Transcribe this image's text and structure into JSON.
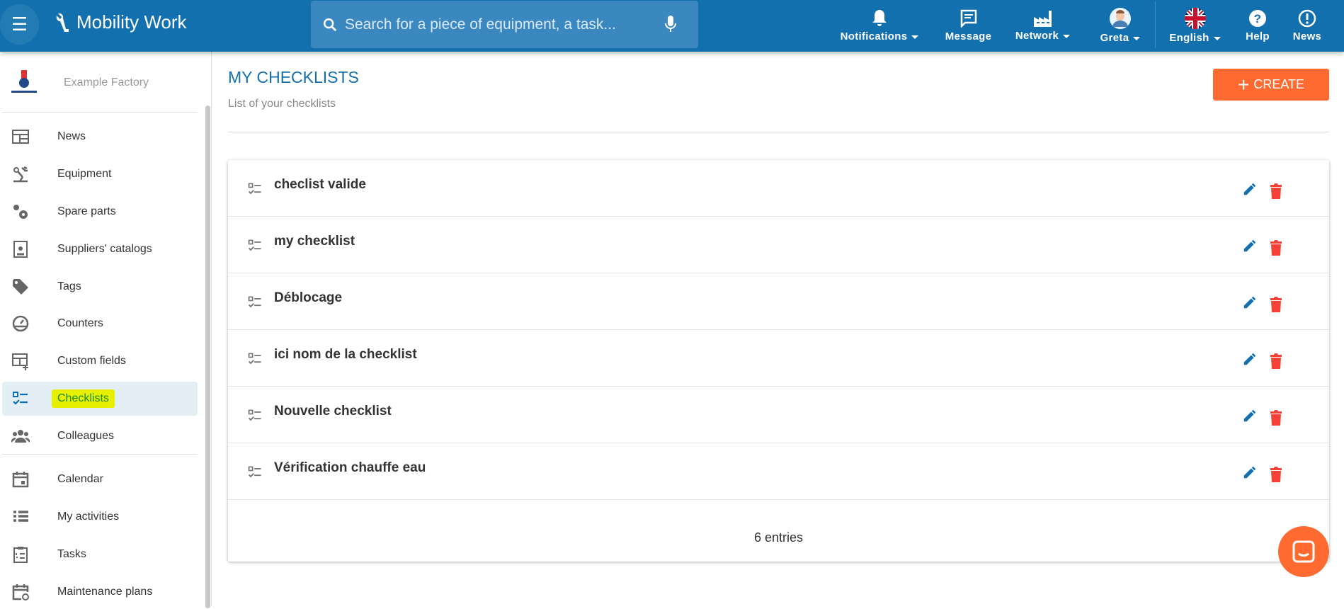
{
  "header": {
    "brand": "Mobility Work",
    "search_placeholder": "Search for a piece of equipment, a task...",
    "nav": [
      {
        "label": "Notifications",
        "icon": "bell-icon"
      },
      {
        "label": "Message",
        "icon": "message-icon"
      },
      {
        "label": "Network",
        "icon": "factory-icon"
      },
      {
        "label": "Greta",
        "icon": "avatar"
      },
      {
        "label": "English",
        "icon": "uk-flag-icon"
      },
      {
        "label": "Help",
        "icon": "help-icon"
      },
      {
        "label": "News",
        "icon": "info-icon"
      }
    ]
  },
  "sidebar": {
    "company": "Example Factory",
    "items": [
      {
        "label": "News",
        "icon": "newspaper-icon"
      },
      {
        "label": "Equipment",
        "icon": "equipment-icon"
      },
      {
        "label": "Spare parts",
        "icon": "gears-icon"
      },
      {
        "label": "Suppliers' catalogs",
        "icon": "catalog-icon"
      },
      {
        "label": "Tags",
        "icon": "tag-icon"
      },
      {
        "label": "Counters",
        "icon": "gauge-icon"
      },
      {
        "label": "Custom fields",
        "icon": "table-plus-icon"
      },
      {
        "label": "Checklists",
        "icon": "checklist-icon",
        "active": true
      },
      {
        "label": "Colleagues",
        "icon": "people-icon"
      },
      {
        "label": "Calendar",
        "icon": "calendar-icon"
      },
      {
        "label": "My activities",
        "icon": "list-icon"
      },
      {
        "label": "Tasks",
        "icon": "clipboard-icon"
      },
      {
        "label": "Maintenance plans",
        "icon": "calendar-sync-icon"
      }
    ]
  },
  "main": {
    "title": "MY CHECKLISTS",
    "subtitle": "List of your checklists",
    "create_label": "CREATE",
    "checklists": [
      "checlist valide",
      "my checklist",
      "Déblocage",
      "ici nom de la checklist",
      "Nouvelle checklist",
      "Vérification chauffe eau"
    ],
    "entries": "6 entries"
  },
  "colors": {
    "primary": "#1170ad",
    "accent": "#ff6a30",
    "delete": "#f44336",
    "highlight": "#e6f000"
  }
}
